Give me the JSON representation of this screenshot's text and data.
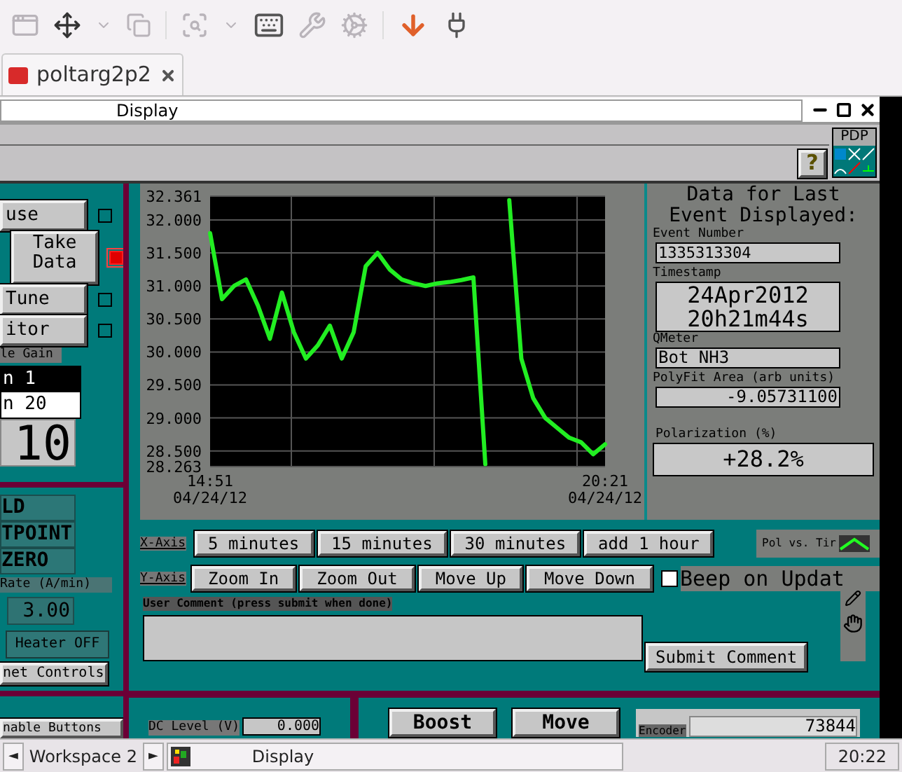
{
  "tabs": [
    {
      "label": "poltarg2p2",
      "selected": true
    }
  ],
  "window": {
    "title": "Display"
  },
  "help_button": {
    "label": "?"
  },
  "pdp_widget": {
    "label": "PDP"
  },
  "left_panel": {
    "controls": [
      {
        "label": "use",
        "checked": false
      },
      {
        "label": "Take Data",
        "checked": true
      },
      {
        "label": "Tune",
        "checked": false
      },
      {
        "label": "itor",
        "checked": false
      }
    ],
    "gain": {
      "label": "le Gain",
      "options": [
        {
          "label": "n 1",
          "selected": true
        },
        {
          "label": "n 20",
          "selected": false
        }
      ],
      "value": "10"
    },
    "magnet": {
      "buttons": [
        "LD",
        "TPOINT",
        "ZERO"
      ],
      "rate_label": "Rate (A/min)",
      "rate": "3.00",
      "heater": "Heater OFF",
      "controls": "net Controls"
    },
    "enable_buttons": "nable Buttons"
  },
  "chart": {
    "chart_data": {
      "type": "line",
      "categories": [
        "14:51 04/24/12",
        null,
        null,
        null,
        null,
        null,
        null,
        null,
        null,
        null,
        null,
        null,
        null,
        null,
        null,
        null,
        null,
        null,
        null,
        null,
        null,
        null,
        null,
        null,
        null,
        null,
        null,
        null,
        null,
        null,
        null,
        null,
        null,
        "20:21 04/24/12"
      ],
      "series": [
        {
          "color": "#22ee22",
          "values": [
            31.8,
            30.8,
            31.0,
            31.1,
            30.7,
            30.2,
            30.9,
            30.3,
            29.9,
            30.1,
            30.4,
            29.9,
            30.3,
            31.3,
            31.5,
            31.25,
            31.1,
            31.04,
            31.0,
            31.04,
            31.06,
            31.09,
            31.13,
            28.3,
            null,
            32.3,
            29.9,
            29.3,
            29.0,
            28.85,
            28.7,
            28.63,
            28.45,
            28.6
          ]
        }
      ],
      "ylim": [
        28.263,
        32.361
      ],
      "grid": true,
      "yticks": [
        {
          "value": 28.263,
          "label": "28.263"
        },
        {
          "value": 28.5,
          "label": "28.500"
        },
        {
          "value": 29,
          "label": "29.000"
        },
        {
          "value": 29.5,
          "label": "29.500"
        },
        {
          "value": 30,
          "label": "30.000"
        },
        {
          "value": 30.5,
          "label": "30.500"
        },
        {
          "value": 31,
          "label": "31.000"
        },
        {
          "value": 31.5,
          "label": "31.500"
        },
        {
          "value": 32,
          "label": "32.000"
        },
        {
          "value": 32.361,
          "label": "32.361"
        }
      ]
    }
  },
  "event_panel": {
    "title": "Data for Last Event Displayed:",
    "fields": [
      {
        "label": "Event Number",
        "value": "1335313304",
        "kind": "small"
      },
      {
        "label": "Timestamp",
        "value": "24Apr2012 20h21m44s",
        "kind": "large"
      },
      {
        "label": "QMeter",
        "value": "Bot NH3",
        "kind": "left"
      },
      {
        "label": "PolyFit Area (arb units)",
        "value": "-9.05731100",
        "kind": "right"
      }
    ],
    "polarization": {
      "label": "Polarization (%)",
      "value": "+28.2%"
    }
  },
  "x_axis": {
    "label": "X-Axis",
    "buttons": [
      "5 minutes",
      "15 minutes",
      "30 minutes",
      "add 1 hour"
    ]
  },
  "plot_selector": {
    "label": "Pol vs. Tir"
  },
  "y_axis": {
    "label": "Y-Axis",
    "buttons": [
      "Zoom In",
      "Zoom Out",
      "Move Up",
      "Move Down"
    ]
  },
  "beep": {
    "label": "Beep on Updat",
    "checked": false
  },
  "comment": {
    "label": "User Comment (press submit when done)",
    "submit": "Submit Comment"
  },
  "dc_level": {
    "label": "DC Level (V)",
    "value": "0.000"
  },
  "motion_buttons": [
    "Boost",
    "Move"
  ],
  "encoder": {
    "label": "Encoder",
    "value": "73844"
  },
  "taskbar": {
    "prev": "◄",
    "workspace": "Workspace 2",
    "next": "►",
    "window": "Display",
    "clock": "20:22"
  }
}
